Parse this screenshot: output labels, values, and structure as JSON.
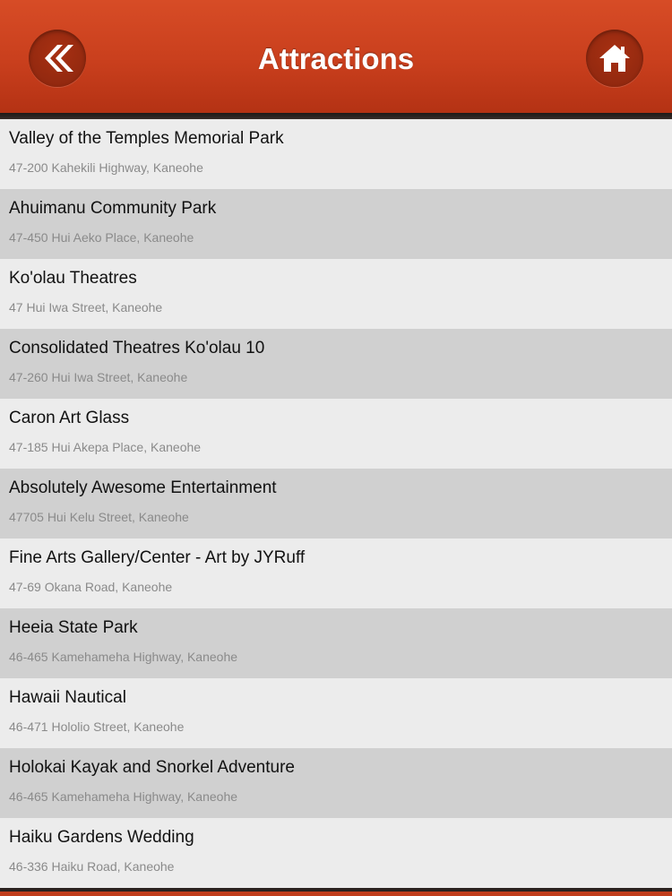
{
  "header": {
    "title": "Attractions",
    "back_icon": "double-chevron-left-icon",
    "home_icon": "home-icon"
  },
  "colors": {
    "header_red": "#c93f1d",
    "row_light": "#ececec",
    "row_dark": "#d0d0d0"
  },
  "attractions": [
    {
      "name": "Valley of the Temples Memorial Park",
      "address": "47-200 Kahekili Highway, Kaneohe"
    },
    {
      "name": "Ahuimanu Community Park",
      "address": "47-450 Hui Aeko Place, Kaneohe"
    },
    {
      "name": "Ko'olau Theatres",
      "address": "47 Hui Iwa Street, Kaneohe"
    },
    {
      "name": "Consolidated Theatres Ko'olau 10",
      "address": "47-260 Hui Iwa Street, Kaneohe"
    },
    {
      "name": "Caron Art Glass",
      "address": "47-185 Hui Akepa Place, Kaneohe"
    },
    {
      "name": "Absolutely Awesome Entertainment",
      "address": "47705 Hui Kelu Street, Kaneohe"
    },
    {
      "name": "Fine Arts Gallery/Center - Art by JYRuff",
      "address": "47-69 Okana Road, Kaneohe"
    },
    {
      "name": "Heeia State Park",
      "address": "46-465 Kamehameha Highway, Kaneohe"
    },
    {
      "name": "Hawaii Nautical",
      "address": "46-471 Hololio Street, Kaneohe"
    },
    {
      "name": "Holokai Kayak and Snorkel Adventure",
      "address": "46-465 Kamehameha Highway, Kaneohe"
    },
    {
      "name": "Haiku Gardens Wedding",
      "address": "46-336 Haiku Road, Kaneohe"
    }
  ]
}
